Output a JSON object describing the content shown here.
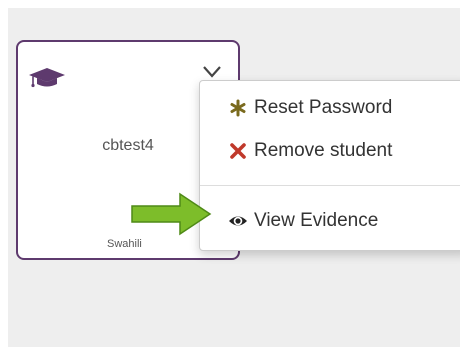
{
  "student_card": {
    "username": "cbtest4",
    "language": "Swahili",
    "icon": "graduation-cap-icon",
    "menu_toggle_icon": "chevron-down-icon"
  },
  "dropdown_menu": {
    "items": [
      {
        "label": "Reset Password",
        "icon": "asterisk-icon",
        "icon_color": "#7a6a1e"
      },
      {
        "label": "Remove student",
        "icon": "times-icon",
        "icon_color": "#c0392b"
      },
      {
        "label": "View Evidence",
        "icon": "eye-icon",
        "icon_color": "#222222"
      }
    ]
  },
  "annotation_arrow": {
    "color": "#7dbd2a",
    "points_to": "View Evidence"
  },
  "colors": {
    "card_border": "#5e3a6e",
    "panel_background": "#eeeeee",
    "text": "#333333"
  }
}
